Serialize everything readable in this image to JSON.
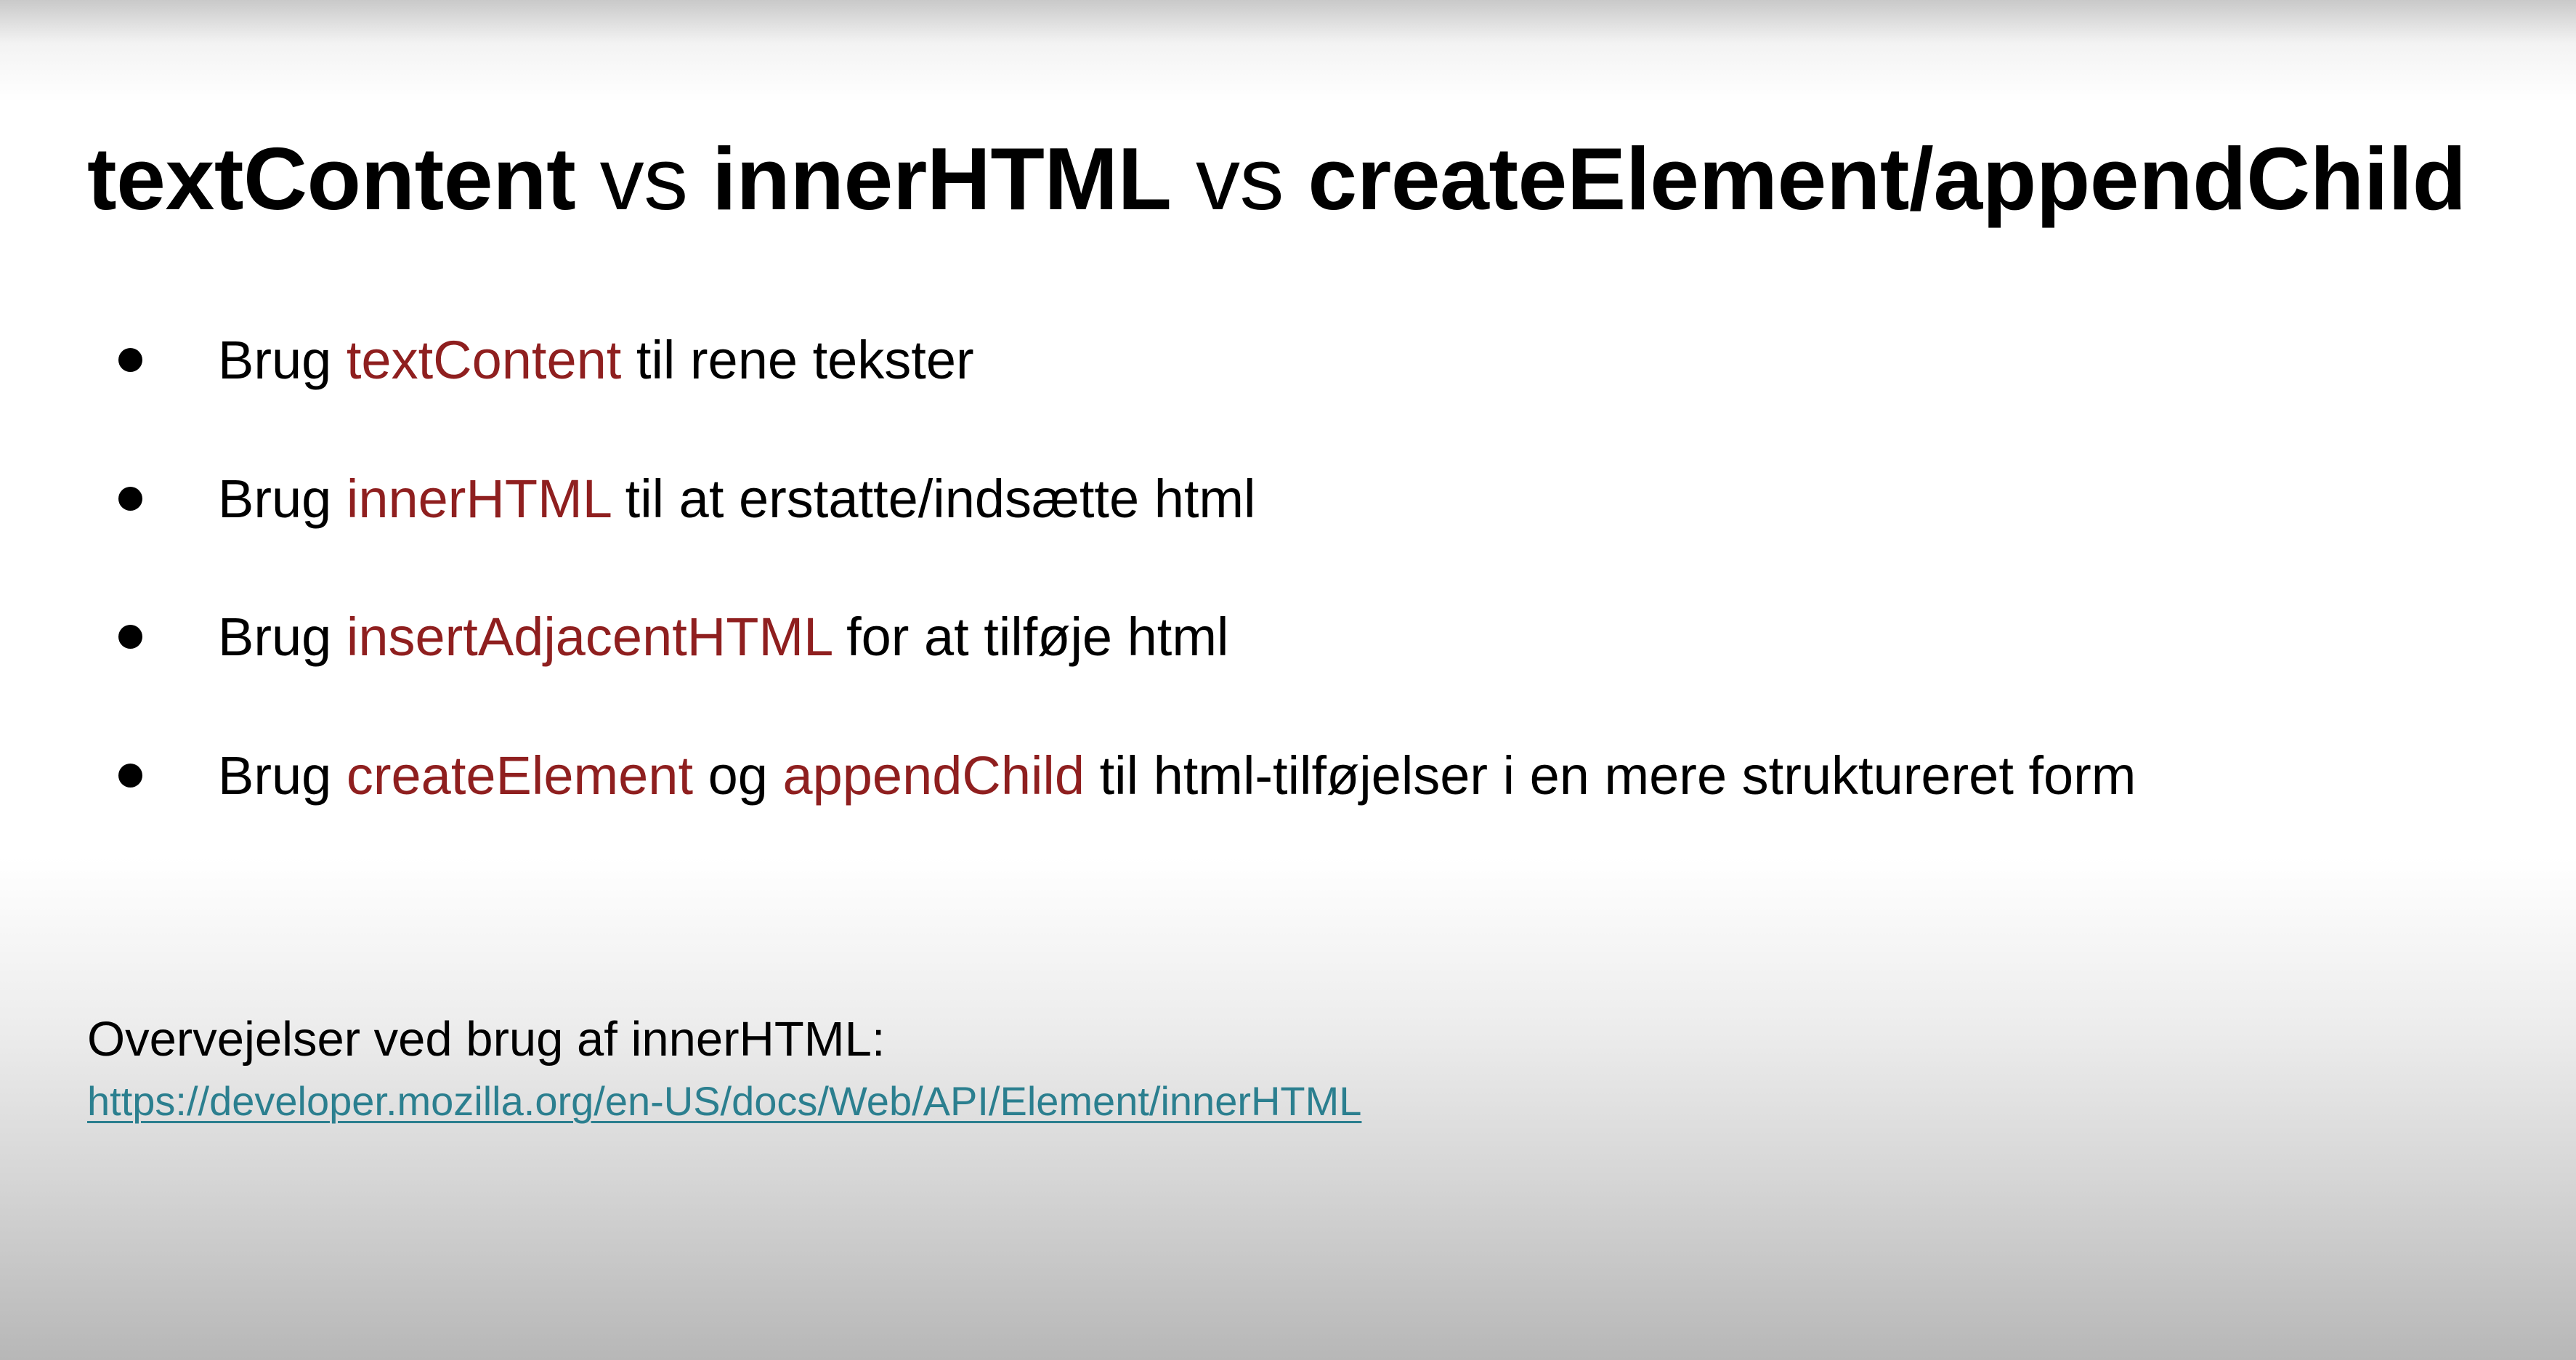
{
  "slide": {
    "title": {
      "part1": "textContent",
      "sep1": " vs ",
      "part2": "innerHTML",
      "sep2": " vs ",
      "part3": "createElement/appendChild"
    },
    "bullets": [
      {
        "lead": "Brug ",
        "term1": "textContent",
        "tail": " til rene tekster"
      },
      {
        "lead": "Brug ",
        "term1": "innerHTML",
        "tail": " til at erstatte/indsætte html"
      },
      {
        "lead": "Brug ",
        "term1": "insertAdjacentHTML",
        "tail": " for at tilføje html"
      },
      {
        "lead": "Brug ",
        "term1": "createElement",
        "mid": " og ",
        "term2": "appendChild",
        "tail": " til html-tilføjelser i en mere struktureret form"
      }
    ],
    "footer": {
      "label": "Overvejelser ved brug af innerHTML:",
      "link": "https://developer.mozilla.org/en-US/docs/Web/API/Element/innerHTML"
    }
  },
  "colors": {
    "code_term": "#8f1f1f",
    "link": "#2b7f8f",
    "text": "#000000"
  }
}
